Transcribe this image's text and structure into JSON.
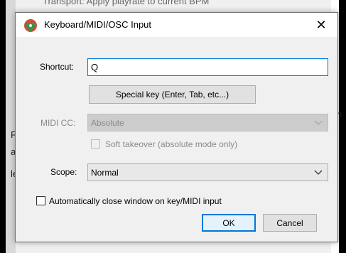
{
  "background": {
    "top_text": "Transport: Apply playrate to current BPM",
    "left_fragments": [
      "Fl",
      "a",
      "le"
    ],
    "right_fragment": "n"
  },
  "dialog": {
    "title": "Keyboard/MIDI/OSC Input",
    "close_glyph": "✕",
    "shortcut": {
      "label": "Shortcut:",
      "value": "Q"
    },
    "special_key_button": "Special key (Enter, Tab, etc...)",
    "midi_cc": {
      "label": "MIDI CC:",
      "value": "Absolute"
    },
    "soft_takeover": {
      "label": "Soft takeover (absolute mode only)",
      "checked": false
    },
    "scope": {
      "label": "Scope:",
      "value": "Normal"
    },
    "auto_close": {
      "label": "Automatically close window on key/MIDI input",
      "checked": false
    },
    "ok_button": "OK",
    "cancel_button": "Cancel"
  },
  "colors": {
    "accent": "#0078d7",
    "icon_red": "#c8513b",
    "icon_green": "#2f9a49"
  }
}
